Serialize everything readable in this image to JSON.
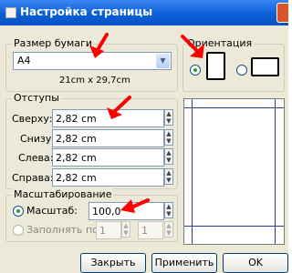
{
  "window": {
    "title": "Настройка страницы"
  },
  "paper": {
    "legend": "Размер бумаги",
    "size_value": "A4",
    "dimensions": "21cm x 29,7cm"
  },
  "orientation": {
    "legend": "Ориентация",
    "selected": "portrait"
  },
  "margins": {
    "legend": "Отступы",
    "fields": [
      {
        "label": "Сверху:",
        "value": "2,82 cm"
      },
      {
        "label": "Снизу:",
        "value": "2,82 cm"
      },
      {
        "label": "Слева:",
        "value": "2,82 cm"
      },
      {
        "label": "Справа:",
        "value": "2,82 cm"
      }
    ]
  },
  "scaling": {
    "legend": "Масштабирование",
    "scale_label": "Масштаб:",
    "scale_value": "100,0",
    "fit_label": "Заполнять по:",
    "fit_width": "1",
    "fit_height": "1",
    "selected": "scale"
  },
  "buttons": {
    "close_label": "Закрыть",
    "apply_label": "Применить",
    "ok_label": "OK"
  },
  "colors": {
    "title_bar": "#0a5fd8",
    "annotation_arrow": "#ff0000",
    "dialog_bg": "#ece9d8"
  }
}
